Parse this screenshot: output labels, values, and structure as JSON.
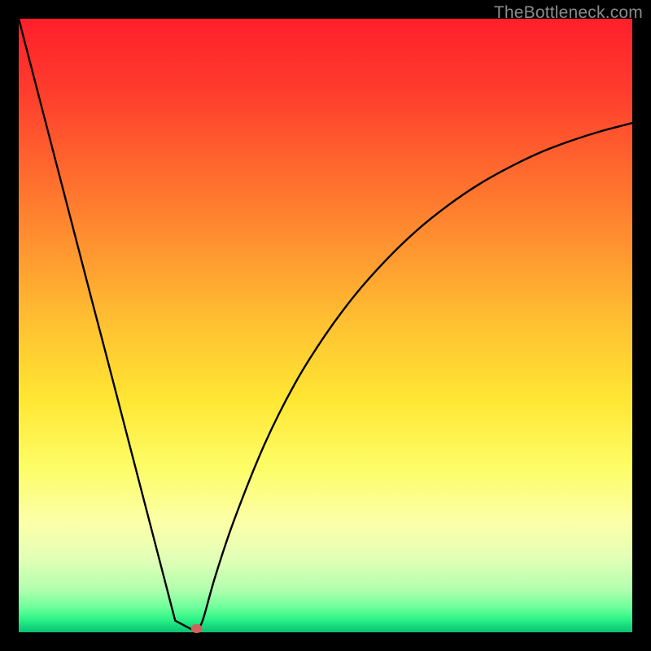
{
  "watermark": "TheBottleneck.com",
  "colors": {
    "frame": "#000000",
    "curve": "#000000",
    "marker_fill": "#d1605e",
    "marker_stroke": "#a94442"
  },
  "chart_data": {
    "type": "line",
    "title": "",
    "xlabel": "",
    "ylabel": "",
    "xlim": [
      0,
      100
    ],
    "ylim": [
      0,
      100
    ],
    "x": [
      0,
      2,
      4,
      6,
      8,
      10,
      12,
      14,
      16,
      18,
      20,
      22,
      24,
      25.5,
      27,
      28,
      29,
      30,
      32,
      35,
      40,
      45,
      50,
      55,
      60,
      65,
      70,
      75,
      80,
      85,
      90,
      95,
      100
    ],
    "values": [
      100,
      92.3,
      84.6,
      76.9,
      69.2,
      61.5,
      53.8,
      46.2,
      38.5,
      30.8,
      23.1,
      15.4,
      7.7,
      1.9,
      0.5,
      0.2,
      0.3,
      2.0,
      9.0,
      18.0,
      30.5,
      40.5,
      48.5,
      55.2,
      60.8,
      65.6,
      69.6,
      73.0,
      75.8,
      78.2,
      80.1,
      81.7,
      83.0
    ],
    "marker": {
      "x": 29,
      "y": 0.6
    },
    "flat_bottom_range": [
      25.5,
      28.5
    ]
  }
}
